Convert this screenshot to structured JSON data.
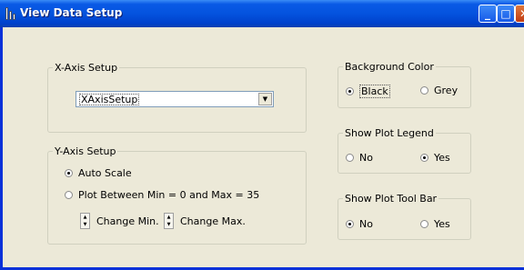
{
  "window": {
    "title": "View Data Setup"
  },
  "x_axis": {
    "group_title": "X-Axis Setup",
    "combo_value": "XAxisSetup"
  },
  "y_axis": {
    "group_title": "Y-Axis Setup",
    "options": [
      {
        "label": "Auto Scale",
        "selected": true
      },
      {
        "label": "Plot Between Min = 0 and Max = 35",
        "selected": false
      }
    ],
    "change_min_label": "Change Min.",
    "change_max_label": "Change Max."
  },
  "background_color": {
    "group_title": "Background Color",
    "options": [
      {
        "label": "Black",
        "selected": true
      },
      {
        "label": "Grey",
        "selected": false
      }
    ]
  },
  "show_plot_legend": {
    "group_title": "Show Plot Legend",
    "options": [
      {
        "label": "No",
        "selected": false
      },
      {
        "label": "Yes",
        "selected": true
      }
    ]
  },
  "show_plot_toolbar": {
    "group_title": "Show Plot Tool Bar",
    "options": [
      {
        "label": "No",
        "selected": true
      },
      {
        "label": "Yes",
        "selected": false
      }
    ]
  },
  "colors": {
    "titlebar": "#0453de",
    "dialog_bg": "#ece9d8",
    "frame": "#0831d9"
  },
  "icons": [
    "app-icon",
    "minimize-icon",
    "maximize-icon",
    "close-icon",
    "combo-arrow-icon",
    "spin-arrows-icon"
  ]
}
